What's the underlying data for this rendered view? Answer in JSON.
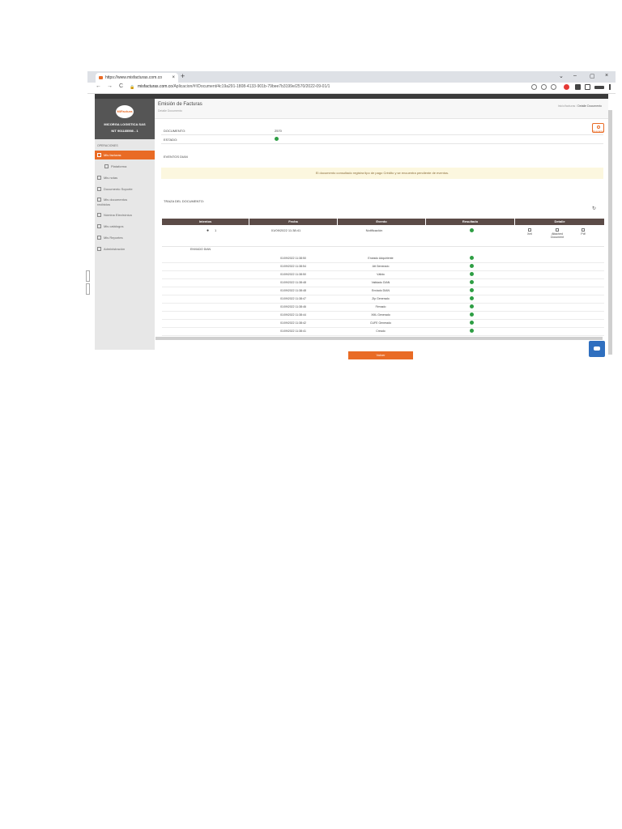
{
  "browser": {
    "tab_title": "https://www.misfacturas.com.co",
    "tab_close": "×",
    "new_tab": "+",
    "url_domain": "misfacturas.com.co",
    "url_path": "/Aplicacion/#!/Document/4c19a291-1808-4133-901b-79bee7b3199e/2570/2022-09-01/1",
    "nav_back": "←",
    "nav_forward": "→",
    "reload": "C",
    "win_min": "–",
    "win_max": "▢",
    "win_close": "×",
    "win_dropdown": "⌄"
  },
  "sidebar": {
    "logo_text": "MiFactura",
    "company": "MICORGA LOGISTICA SAS",
    "nit": "NIT 901185598 - 1",
    "section": "OPERACIONES",
    "items": [
      {
        "label": "Mis facturas",
        "active": true
      },
      {
        "label": "Plataforma",
        "active": false
      },
      {
        "label": "Mis notas",
        "active": false
      },
      {
        "label": "Documento Soporte",
        "active": false
      },
      {
        "label": "Mis documentos recibidos",
        "active": false
      },
      {
        "label": "Nómina Electrónica",
        "active": false
      },
      {
        "label": "Mis catálogos",
        "active": false
      },
      {
        "label": "Mis Reportes",
        "active": false
      },
      {
        "label": "Administración",
        "active": false
      }
    ]
  },
  "header": {
    "title": "Emisión de Facturas",
    "subtitle": "Detalle Documento",
    "crumb_home": "Inicio/facturas",
    "crumb_current": "Detalle Documento",
    "export_button": "Descargar"
  },
  "document": {
    "documento_label": "DOCUMENTO:",
    "documento_value": "2570",
    "estado_label": "ESTADO:",
    "eventos_label": "EVENTOS DIAN",
    "notice": "El documento consultado registra tipo de pago Crédito y se encuentra pendiente de eventos.",
    "traza_label": "TRAZA DEL DOCUMENTO:"
  },
  "table": {
    "headers": [
      "Intentos",
      "Fecha",
      "Evento",
      "Resultado",
      "Detalle"
    ],
    "main_row": {
      "intentos": "1",
      "fecha": "01/09/2022 11:38:41",
      "evento": "Notificación"
    },
    "detail_links": [
      "Xml",
      "Attached Document",
      "Pdf"
    ],
    "group_label": "ENVIADO DIAN",
    "rows": [
      {
        "fecha": "01/09/2022 11:38:50",
        "evento": "Enviado Adquiriente"
      },
      {
        "fecha": "01/09/2022 11:38:54",
        "evento": "Att Generado"
      },
      {
        "fecha": "01/09/2022 11:38:50",
        "evento": "Válido"
      },
      {
        "fecha": "01/09/2022 11:38:48",
        "evento": "Validado DIAN"
      },
      {
        "fecha": "01/09/2022 11:38:48",
        "evento": "Enviado DIAN"
      },
      {
        "fecha": "01/09/2022 11:38:47",
        "evento": "Zip Generado"
      },
      {
        "fecha": "01/09/2022 11:38:46",
        "evento": "Firmado"
      },
      {
        "fecha": "01/09/2022 11:38:44",
        "evento": "XML Generado"
      },
      {
        "fecha": "01/09/2022 11:38:42",
        "evento": "CUFE Generado"
      },
      {
        "fecha": "01/09/2022 11:38:41",
        "evento": "Creado"
      }
    ]
  },
  "actions": {
    "back_button": "Volver"
  },
  "colors": {
    "accent": "#e96b25",
    "table_header": "#5b4b47",
    "success": "#2e9e44",
    "notice_bg": "#fcf7df"
  }
}
